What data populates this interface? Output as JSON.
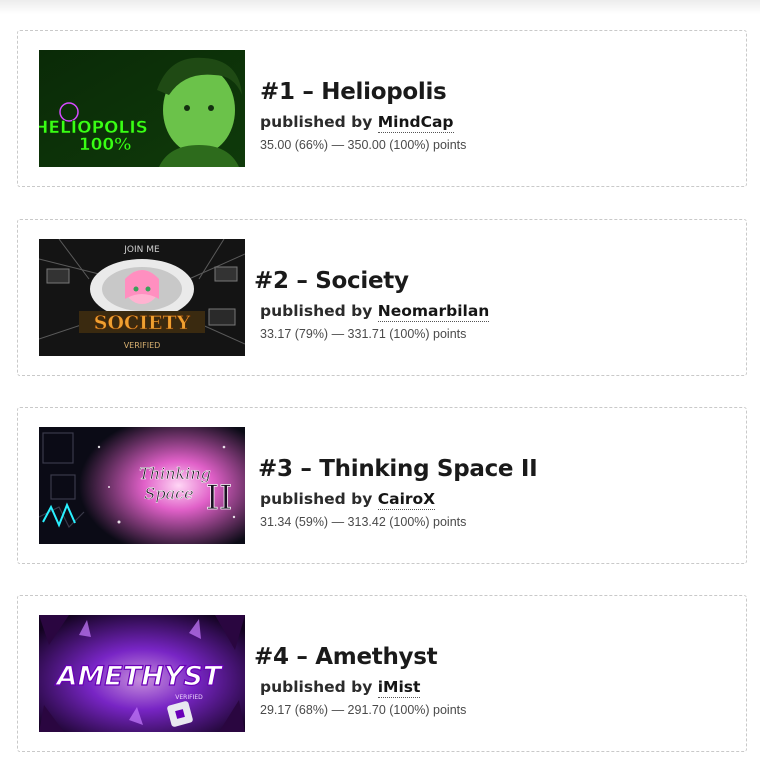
{
  "levels": [
    {
      "title": "#1 – Heliopolis",
      "published_prefix": "published by",
      "author": "MindCap",
      "points": "35.00 (66%) — 350.00 (100%) points",
      "thumb_text": [
        "HELIOPOLIS",
        "100%"
      ],
      "thumb_colors": {
        "bg": "#0a1a08",
        "accent": "#39ff14"
      }
    },
    {
      "title": "#2 – Society",
      "published_prefix": "published by",
      "author": "Neomarbilan",
      "points": "33.17 (79%) — 331.71 (100%) points",
      "thumb_text": [
        "JOIN ME",
        "SOCIETY",
        "VERIFIED"
      ],
      "thumb_colors": {
        "bg": "#1a1a1a",
        "accent": "#ff4d9a"
      }
    },
    {
      "title": "#3 – Thinking Space II",
      "published_prefix": "published by",
      "author": "CairoX",
      "points": "31.34 (59%) — 313.42 (100%) points",
      "thumb_text": [
        "Thinking",
        "Space",
        "II"
      ],
      "thumb_colors": {
        "bg": "#0b0b16",
        "accent": "#ff7ae0"
      }
    },
    {
      "title": "#4 – Amethyst",
      "published_prefix": "published by",
      "author": "iMist",
      "points": "29.17 (68%) — 291.70 (100%) points",
      "thumb_text": [
        "AMETHYST",
        "VERIFIED"
      ],
      "thumb_colors": {
        "bg": "#12021f",
        "accent": "#b84cff"
      }
    }
  ]
}
